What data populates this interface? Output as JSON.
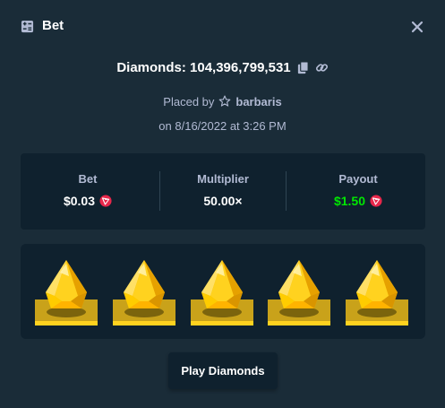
{
  "header": {
    "title": "Bet",
    "title_icon": "bet-slip-icon",
    "close_icon": "close-icon"
  },
  "diamonds": {
    "label": "Diamonds: 104,396,799,531",
    "copy_icon": "copy-icon",
    "link_icon": "link-icon"
  },
  "placed": {
    "prefix": "Placed by",
    "user_icon": "star-icon",
    "username": "barbaris",
    "date": "on 8/16/2022 at 3:26 PM"
  },
  "stats": {
    "bet_label": "Bet",
    "bet_value": "$0.03",
    "multiplier_label": "Multiplier",
    "multiplier_value": "50.00×",
    "payout_label": "Payout",
    "payout_value": "$1.50",
    "currency_icon": "tron-coin-icon",
    "payout_color": "#00e701"
  },
  "game": {
    "gems": [
      {
        "name": "yellow-gem-icon"
      },
      {
        "name": "yellow-gem-icon"
      },
      {
        "name": "yellow-gem-icon"
      },
      {
        "name": "yellow-gem-icon"
      },
      {
        "name": "yellow-gem-icon"
      }
    ]
  },
  "play_button": {
    "label": "Play Diamonds"
  },
  "colors": {
    "background": "#1a2c38",
    "panel": "#0f212e",
    "muted_text": "#b1bad3",
    "win_green": "#00e701",
    "gem_yellow": "#ffd21f",
    "coin_red": "#e8274b"
  }
}
